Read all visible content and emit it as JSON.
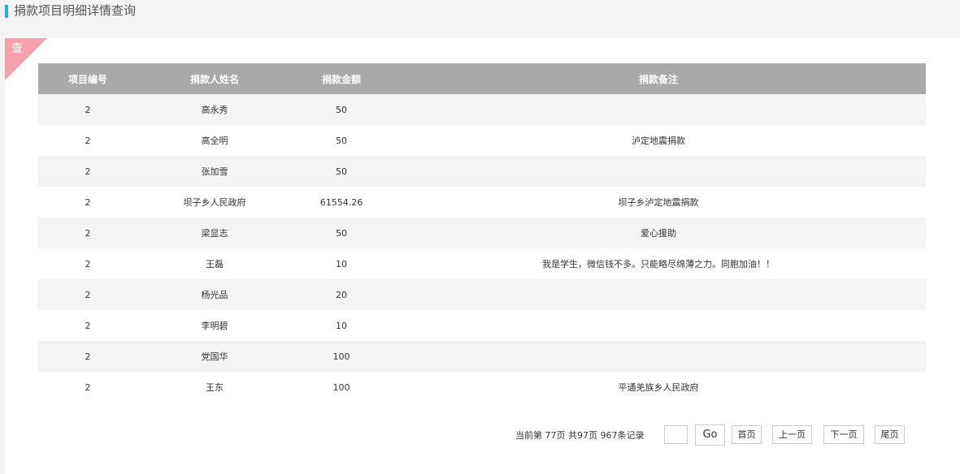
{
  "header": {
    "title": "捐款项目明细详情查询"
  },
  "card": {
    "corner_label": "查"
  },
  "table": {
    "columns": [
      "项目编号",
      "捐款人姓名",
      "捐款金额",
      "捐款备注"
    ],
    "rows": [
      [
        "2",
        "高永秀",
        "50",
        ""
      ],
      [
        "2",
        "高全明",
        "50",
        "泸定地震捐款"
      ],
      [
        "2",
        "张加雪",
        "50",
        ""
      ],
      [
        "2",
        "坝子乡人民政府",
        "61554.26",
        "坝子乡泸定地震捐款"
      ],
      [
        "2",
        "梁显志",
        "50",
        "爱心援助"
      ],
      [
        "2",
        "王磊",
        "10",
        "我是学生，微信钱不多。只能略尽绵薄之力。同胞加油！！"
      ],
      [
        "2",
        "杨光品",
        "20",
        ""
      ],
      [
        "2",
        "李明碧",
        "10",
        ""
      ],
      [
        "2",
        "党国华",
        "100",
        ""
      ],
      [
        "2",
        "王东",
        "100",
        "平通羌族乡人民政府"
      ]
    ]
  },
  "pager": {
    "current_prefix": "当前第",
    "current_page": "77页",
    "total_pages": "共97页",
    "total_records": "967条记录",
    "page_input_value": "",
    "go_label": "Go",
    "first_label": "首页",
    "prev_label": "上一页",
    "next_label": "下一页",
    "last_label": "尾页"
  }
}
